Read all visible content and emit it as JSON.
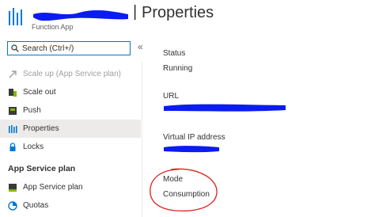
{
  "header": {
    "title": "Properties",
    "separator": "|",
    "subtitle": "Function App"
  },
  "search": {
    "placeholder": "Search (Ctrl+/)"
  },
  "sidebar": {
    "collapse_label": "«",
    "items": [
      {
        "label": "Scale up (App Service plan)",
        "icon": "scale-up-icon",
        "disabled": true
      },
      {
        "label": "Scale out",
        "icon": "scale-out-icon"
      },
      {
        "label": "Push",
        "icon": "push-icon"
      },
      {
        "label": "Properties",
        "icon": "properties-icon",
        "active": true
      },
      {
        "label": "Locks",
        "icon": "lock-icon"
      }
    ],
    "section": {
      "title": "App Service plan",
      "items": [
        {
          "label": "App Service plan",
          "icon": "app-service-plan-icon"
        },
        {
          "label": "Quotas",
          "icon": "quotas-icon"
        }
      ]
    }
  },
  "properties": {
    "status_label": "Status",
    "status_value": "Running",
    "url_label": "URL",
    "ip_label": "Virtual IP address",
    "mode_label": "Mode",
    "mode_value": "Consumption"
  },
  "colors": {
    "accent": "#0078d4",
    "redaction": "#0a1cf0",
    "annotation": "#e0201e",
    "active_bg": "#edebe9"
  }
}
